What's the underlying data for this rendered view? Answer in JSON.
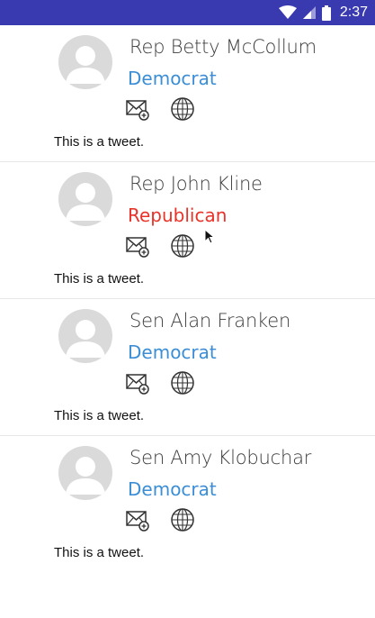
{
  "status_bar": {
    "time": "2:37",
    "background": "#3a3ab0"
  },
  "colors": {
    "democrat": "#3b8ed6",
    "republican": "#e8332a"
  },
  "representatives": [
    {
      "name": "Rep Betty McCollum",
      "party": "Democrat",
      "tweet": "This is a tweet."
    },
    {
      "name": "Rep John Kline",
      "party": "Republican",
      "tweet": "This is a tweet."
    },
    {
      "name": "Sen Alan Franken",
      "party": "Democrat",
      "tweet": "This is a tweet."
    },
    {
      "name": "Sen Amy Klobuchar",
      "party": "Democrat",
      "tweet": "This is a tweet."
    }
  ],
  "icons": {
    "avatar": "person-placeholder-icon",
    "email": "email-icon",
    "website": "website-icon"
  }
}
